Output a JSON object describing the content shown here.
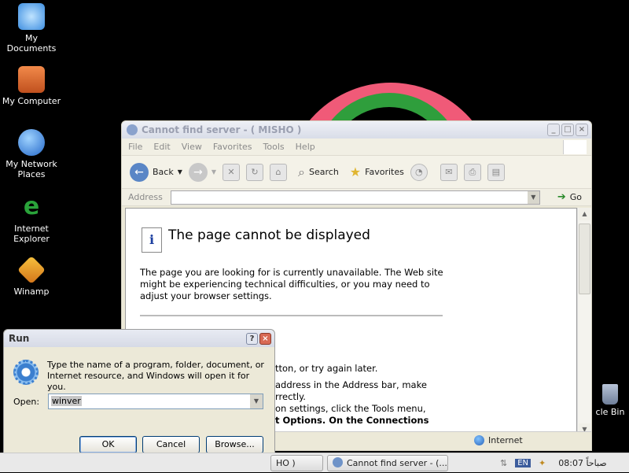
{
  "desktop": {
    "icons": [
      {
        "label": "My Documents"
      },
      {
        "label": "My Computer"
      },
      {
        "label": "My Network Places"
      },
      {
        "label": "Internet Explorer"
      },
      {
        "label": "Winamp"
      }
    ],
    "recycle_label": "cle Bin"
  },
  "ie_window": {
    "title": "Cannot find server - ( MISHO )",
    "menu": [
      "File",
      "Edit",
      "View",
      "Favorites",
      "Tools",
      "Help"
    ],
    "toolbar": {
      "back": "Back",
      "search": "Search",
      "favorites": "Favorites"
    },
    "address_label": "Address",
    "address_value": "",
    "go_label": "Go",
    "page": {
      "heading": "The page cannot be displayed",
      "body": "The page you are looking for is currently unavailable. The Web site might be experiencing technical difficulties, or you may need to adjust your browser settings.",
      "partial_lines": [
        "tton, or try again later.",
        "address in the Address bar, make",
        "rrectly.",
        "on settings, click the Tools menu,",
        "t Options. On the Connections"
      ]
    },
    "status_zone": "Internet"
  },
  "run_dialog": {
    "title": "Run",
    "description": "Type the name of a program, folder, document, or Internet resource, and Windows will open it for you.",
    "open_label": "Open:",
    "open_value": "winver",
    "ok": "OK",
    "cancel": "Cancel",
    "browse": "Browse..."
  },
  "taskbar": {
    "tasks": [
      {
        "label": "HO )"
      },
      {
        "label": "Cannot find server - (..."
      }
    ],
    "language": "EN",
    "clock": "08:07 صباحاً"
  }
}
